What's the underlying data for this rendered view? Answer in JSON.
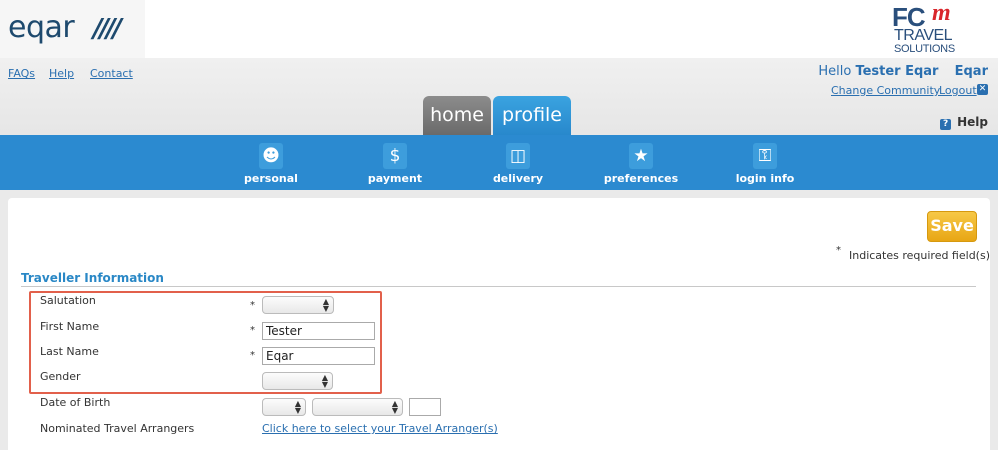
{
  "header": {
    "logo_text": "eqar",
    "logo_slashes": "////",
    "brand": {
      "fc": "FC",
      "m": "m",
      "travel": "TRAVEL",
      "solutions": "SOLUTIONS"
    },
    "links": [
      "FAQs",
      "Help",
      "Contact"
    ],
    "hello_prefix": "Hello",
    "user_name": "Tester Eqar",
    "community": "Eqar",
    "change_community": "Change Community",
    "logout": "Logout",
    "help": "Help"
  },
  "tabs": [
    {
      "label": "home",
      "active": false
    },
    {
      "label": "profile",
      "active": true
    }
  ],
  "nav": [
    {
      "label": "personal",
      "icon": "person-icon"
    },
    {
      "label": "payment",
      "icon": "money-icon"
    },
    {
      "label": "delivery",
      "icon": "box-icon"
    },
    {
      "label": "preferences",
      "icon": "star-icon"
    },
    {
      "label": "login info",
      "icon": "lock-icon"
    }
  ],
  "form": {
    "save_label": "Save",
    "required_star": "*",
    "required_note": "Indicates required field(s)",
    "section_title": "Traveller Information",
    "fields": {
      "salutation": {
        "label": "Salutation",
        "value": ""
      },
      "first_name": {
        "label": "First Name",
        "value": "Tester"
      },
      "last_name": {
        "label": "Last Name",
        "value": "Eqar"
      },
      "gender": {
        "label": "Gender",
        "value": ""
      },
      "dob": {
        "label": "Date of Birth",
        "day": "",
        "month": "",
        "year": ""
      },
      "arrangers": {
        "label": "Nominated Travel Arrangers",
        "link": "Click here to select your Travel Arranger(s)"
      }
    }
  },
  "colors": {
    "nav_blue": "#2b8ad0",
    "link_blue": "#2a6fb0",
    "save_gold": "#e8a614",
    "highlight_red": "#e2604b"
  }
}
